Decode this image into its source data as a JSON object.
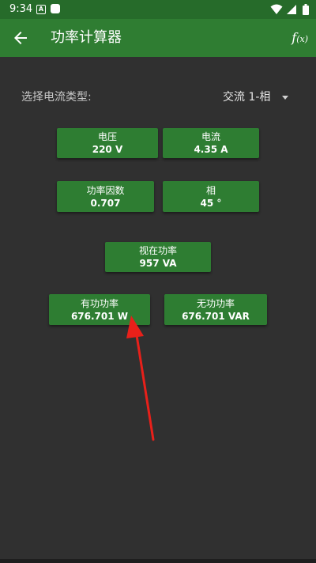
{
  "status_bar": {
    "time": "9:34"
  },
  "app_bar": {
    "title": "功率计算器",
    "fx_label": "f",
    "fx_sub": "(x)"
  },
  "current_type": {
    "label": "选择电流类型:",
    "selected": "交流 1-相"
  },
  "buttons": {
    "voltage": {
      "title": "电压",
      "value": "220 V"
    },
    "current": {
      "title": "电流",
      "value": "4.35 A"
    },
    "power_factor": {
      "title": "功率因数",
      "value": "0.707"
    },
    "phase": {
      "title": "相",
      "value": "45 °"
    },
    "apparent_power": {
      "title": "视在功率",
      "value": "957 VA"
    },
    "active_power": {
      "title": "有功功率",
      "value": "676.701 W"
    },
    "reactive_power": {
      "title": "无功功率",
      "value": "676.701 VAR"
    }
  },
  "colors": {
    "app_bar": "#2f7d32",
    "status_bar": "#266b2a",
    "button": "#2e7d32",
    "background": "#303030",
    "annotation_arrow": "#e8201a"
  }
}
